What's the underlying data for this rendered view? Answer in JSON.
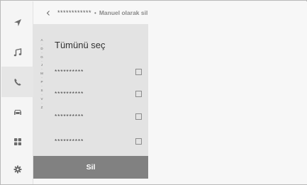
{
  "header": {
    "contact_name": "************",
    "separator": "•",
    "title": "Manuel olarak sil"
  },
  "sidebar": {
    "items": [
      {
        "icon": "navigation-icon"
      },
      {
        "icon": "music-icon"
      },
      {
        "icon": "phone-icon",
        "active": true
      },
      {
        "icon": "car-icon"
      },
      {
        "icon": "apps-icon"
      },
      {
        "icon": "settings-icon"
      }
    ]
  },
  "list": {
    "select_all_label": "Tümünü seç",
    "alpha_index": [
      "A",
      "·",
      "D",
      "·",
      "G",
      "·",
      "J",
      "·",
      "M",
      "·",
      "P",
      "·",
      "S",
      "·",
      "V",
      "·",
      "Z"
    ],
    "rows": [
      {
        "label": "**********",
        "checked": false
      },
      {
        "label": "**********",
        "checked": false
      },
      {
        "label": "**********",
        "checked": false
      },
      {
        "label": "**********",
        "checked": false
      }
    ]
  },
  "footer": {
    "delete_label": "Sil"
  },
  "colors": {
    "panel": "#e3e3e3",
    "delete_button": "#818181",
    "active_nav": "#e6e6e6",
    "icon": "#6b6b6b"
  }
}
